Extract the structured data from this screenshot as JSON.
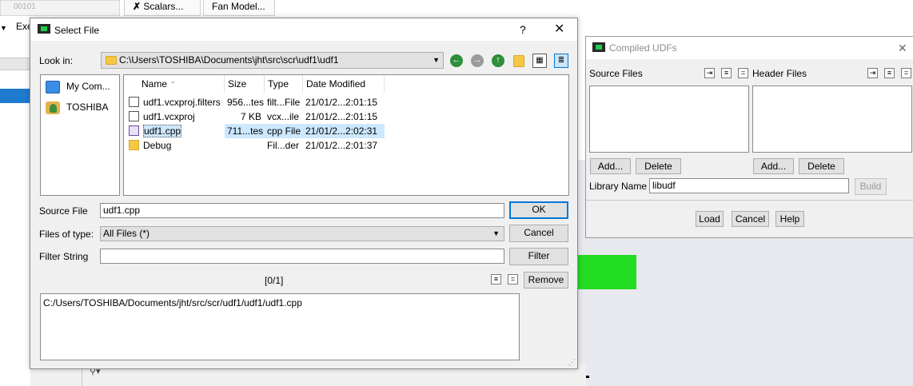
{
  "background": {
    "field_text": "00101",
    "exe_label": "Exe",
    "scalars_button": "Scalars...",
    "fan_model_button": "Fan Model..."
  },
  "select_file": {
    "title": "Select File",
    "help": "?",
    "close": "✕",
    "look_in_label": "Look in:",
    "look_in_path": "C:\\Users\\TOSHIBA\\Documents\\jht\\src\\scr\\udf1\\udf1",
    "places": [
      {
        "label": "My Com...",
        "icon": "computer-icon"
      },
      {
        "label": "TOSHIBA",
        "icon": "user-folder-icon"
      }
    ],
    "columns": {
      "name": "Name",
      "size": "Size",
      "type": "Type",
      "date": "Date Modified"
    },
    "files": [
      {
        "name": "udf1.vcxproj.filters",
        "size": "956...tes",
        "type": "filt...File",
        "date": "21/01/2...2:01:15",
        "icon": "filters-file-icon",
        "selected": false
      },
      {
        "name": "udf1.vcxproj",
        "size": "7 KB",
        "type": "vcx...ile",
        "date": "21/01/2...2:01:15",
        "icon": "vcxproj-file-icon",
        "selected": false
      },
      {
        "name": "udf1.cpp",
        "size": "711...tes",
        "type": "cpp File",
        "date": "21/01/2...2:02:31",
        "icon": "cpp-file-icon",
        "selected": true
      },
      {
        "name": "Debug",
        "size": "",
        "type": "Fil...der",
        "date": "21/01/2...2:01:37",
        "icon": "folder-icon",
        "selected": false
      }
    ],
    "source_file_label": "Source File",
    "source_file_value": "udf1.cpp",
    "ok": "OK",
    "files_of_type_label": "Files of type:",
    "files_of_type_value": "All Files (*)",
    "cancel": "Cancel",
    "filter_string_label": "Filter String",
    "filter_string_value": "",
    "filter": "Filter",
    "count": "[0/1]",
    "remove": "Remove",
    "selected_paths": "C:/Users/TOSHIBA/Documents/jht/src/scr/udf1/udf1/udf1.cpp"
  },
  "compiled_udfs": {
    "title": "Compiled UDFs",
    "close": "✕",
    "source_files_label": "Source Files",
    "header_files_label": "Header Files",
    "add": "Add...",
    "delete": "Delete",
    "library_name_label": "Library Name",
    "library_name_value": "libudf",
    "build": "Build",
    "load": "Load",
    "cancel": "Cancel",
    "help": "Help"
  },
  "colors": {
    "accent": "#0078d7",
    "selection": "#cce8ff",
    "graphics_green": "#22dd22",
    "sidebar_blue": "#1f7bd0"
  }
}
